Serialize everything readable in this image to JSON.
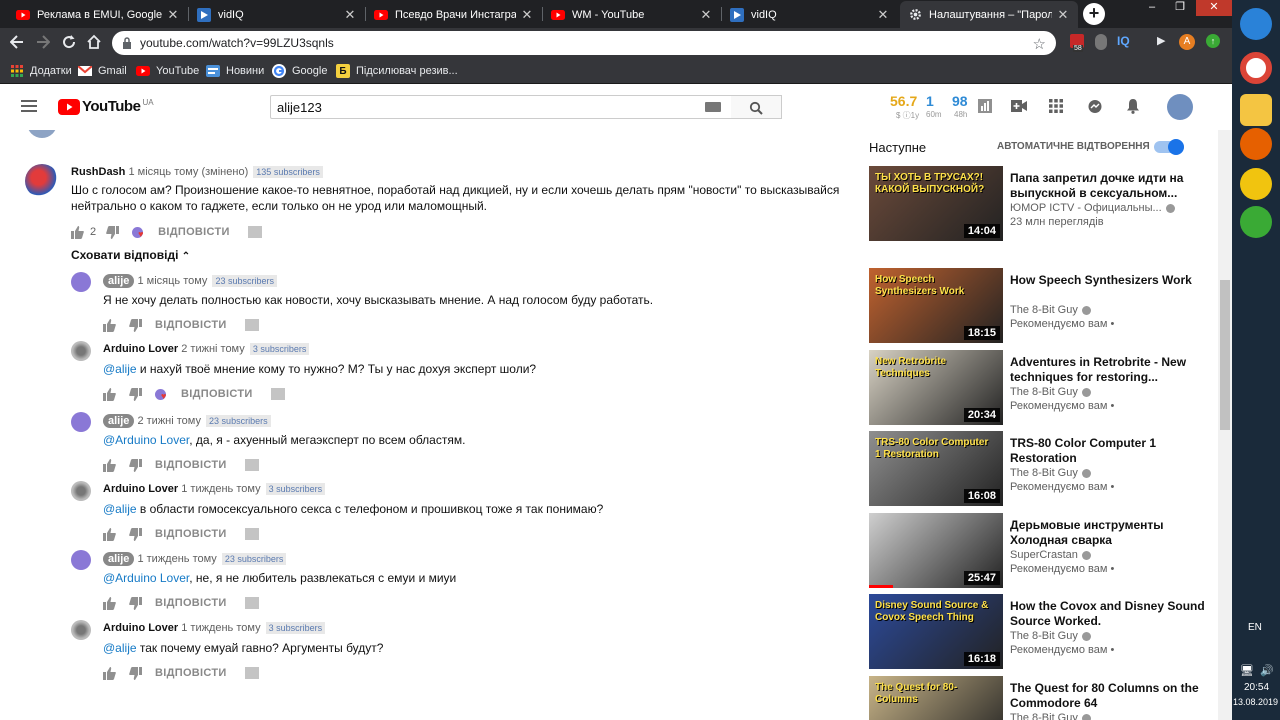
{
  "browser": {
    "tabs": [
      {
        "title": "Реклама в EMUI, Google Pixel",
        "icon": "youtube-icon"
      },
      {
        "title": "vidIQ",
        "icon": "vidiq-icon"
      },
      {
        "title": "Псевдо Врачи Инстаграма: К",
        "icon": "youtube-icon"
      },
      {
        "title": "WM - YouTube",
        "icon": "youtube-icon"
      },
      {
        "title": "vidIQ",
        "icon": "vidiq-icon"
      },
      {
        "title": "Налаштування – \"Паролі\"",
        "icon": "gear-icon"
      }
    ],
    "url": "youtube.com/watch?v=99LZU3sqnls",
    "bookmarks": [
      {
        "label": "Додатки",
        "icon": "apps-icon"
      },
      {
        "label": "Gmail",
        "icon": "gmail-icon"
      },
      {
        "label": "YouTube",
        "icon": "youtube-icon"
      },
      {
        "label": "Новини",
        "icon": "news-icon"
      },
      {
        "label": "Google",
        "icon": "google-icon"
      },
      {
        "label": "Підсилювач резив...",
        "icon": "bookmark-icon"
      }
    ],
    "ext_badge": "58"
  },
  "youtube": {
    "logo": "YouTube",
    "region": "UA",
    "search_value": "alije123",
    "stats": [
      {
        "value": "56.7",
        "sub": "$ ⓘ1y"
      },
      {
        "value": "1",
        "sub": "60m"
      },
      {
        "value": "98",
        "sub": "48h"
      }
    ],
    "up_next": "Наступне",
    "autoplay": "АВТОМАТИЧНЕ ВІДТВОРЕННЯ",
    "hide_replies": "Сховати відповіді",
    "reply_label": "ВІДПОВІСТИ"
  },
  "comments": [
    {
      "author": "RushDash",
      "time": "1 місяць тому (змінено)",
      "subs": "135 subscribers",
      "line1": "Шо с голосом ам? Произношение какое-то невнятное, поработай над дикцией, ну и если хочешь делать прям \"новости\" то высказывайся",
      "line2": "нейтрально о каком то гаджете, если только он не урод или маломощный.",
      "likes": "2"
    }
  ],
  "replies": [
    {
      "author": "alije",
      "badge": true,
      "time": "1 місяць тому",
      "subs": "23 subscribers",
      "mention": "",
      "text": "Я не хочу делать полностью как новости, хочу высказывать мнение. А над голосом буду работать.",
      "heart": false
    },
    {
      "author": "Arduino Lover",
      "badge": false,
      "time": "2 тижні тому",
      "subs": "3 subscribers",
      "mention": "@alije",
      "text": " и нахуй твоё мнение кому то нужно? М? Ты у нас дохуя эксперт шоли?",
      "heart": true
    },
    {
      "author": "alije",
      "badge": true,
      "time": "2 тижні тому",
      "subs": "23 subscribers",
      "mention": "@Arduino Lover",
      "text": ", да, я - ахуенный мегаэксперт по всем областям.",
      "heart": false
    },
    {
      "author": "Arduino Lover",
      "badge": false,
      "time": "1 тиждень тому",
      "subs": "3 subscribers",
      "mention": "@alije",
      "text": " в области гомосексуального секса с телефоном и прошивкоц тоже я так понимаю?",
      "heart": false
    },
    {
      "author": "alije",
      "badge": true,
      "time": "1 тиждень тому",
      "subs": "23 subscribers",
      "mention": "@Arduino Lover",
      "text": ", не, я не любитель развлекаться с емуи и миуи",
      "heart": false
    },
    {
      "author": "Arduino Lover",
      "badge": false,
      "time": "1 тиждень тому",
      "subs": "3 subscribers",
      "mention": "@alije",
      "text": " так почему емуай гавно? Аргументы будут?",
      "heart": false
    }
  ],
  "videos": [
    {
      "title": "Папа запретил дочке идти на выпускной в сексуальном...",
      "channel": "ЮМОР ICTV - Официальны...",
      "views": "23 млн переглядів",
      "duration": "14:04",
      "thumb_text": "ТЫ ХОТЬ В ТРУСАХ?! КАКОЙ ВЫПУСКНОЙ?",
      "color": "#6b4a3a"
    },
    {
      "title": "How Speech Synthesizers Work",
      "channel": "The 8-Bit Guy",
      "views": "Рекомендуємо вам",
      "duration": "18:15",
      "thumb_text": "How Speech Synthesizers Work",
      "color": "#c0622f"
    },
    {
      "title": "Adventures in Retrobrite - New techniques for restoring...",
      "channel": "The 8-Bit Guy",
      "views": "Рекомендуємо вам",
      "duration": "20:34",
      "thumb_text": "New Retrobrite Techniques",
      "color": "#d8d2c4"
    },
    {
      "title": "TRS-80 Color Computer 1 Restoration",
      "channel": "The 8-Bit Guy",
      "views": "Рекомендуємо вам",
      "duration": "16:08",
      "thumb_text": "TRS-80 Color Computer 1 Restoration",
      "color": "#8f8f8f"
    },
    {
      "title": "Дерьмовые инструменты Холодная сварка",
      "channel": "SuperCrastan",
      "views": "Рекомендуємо вам",
      "duration": "25:47",
      "thumb_text": "",
      "color": "#cfcfcf"
    },
    {
      "title": "How the Covox and Disney Sound Source Worked.",
      "channel": "The 8-Bit Guy",
      "views": "Рекомендуємо вам",
      "duration": "16:18",
      "thumb_text": "Disney Sound Source & Covox Speech Thing",
      "color": "#2c4a9a"
    },
    {
      "title": "The Quest for 80 Columns on the Commodore 64",
      "channel": "The 8-Bit Guy",
      "views": "",
      "duration": "",
      "thumb_text": "The Quest for 80-Columns",
      "color": "#c8b488"
    }
  ],
  "taskbar": {
    "lang": "EN",
    "time": "20:54",
    "date": "13.08.2019"
  }
}
